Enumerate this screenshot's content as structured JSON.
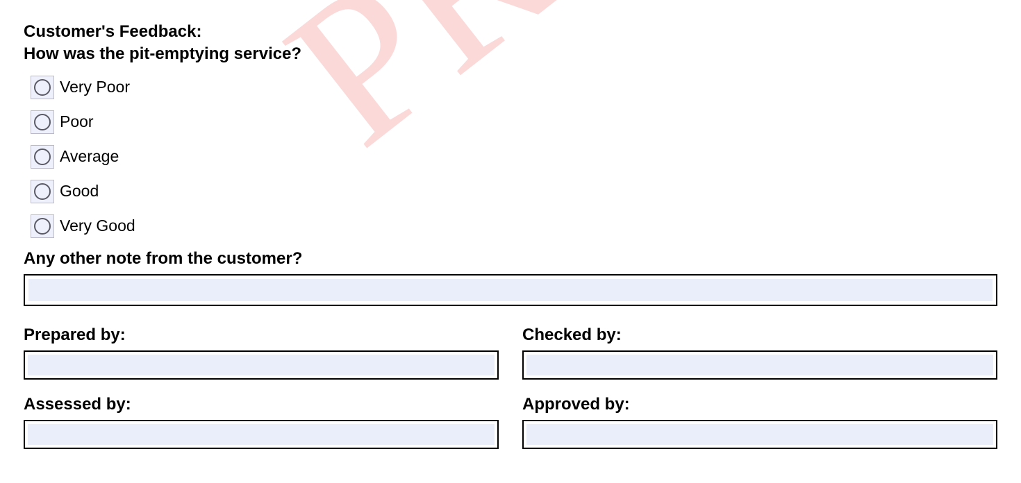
{
  "feedback": {
    "title": "Customer's Feedback:",
    "question": "How was the pit-emptying service?",
    "options": {
      "opt1": "Very Poor",
      "opt2": "Poor",
      "opt3": "Average",
      "opt4": "Good",
      "opt5": "Very Good"
    },
    "note_question": "Any other note from the customer?"
  },
  "signoff": {
    "prepared": "Prepared by:",
    "checked": "Checked by:",
    "assessed": "Assessed by:",
    "approved": "Approved by:"
  }
}
